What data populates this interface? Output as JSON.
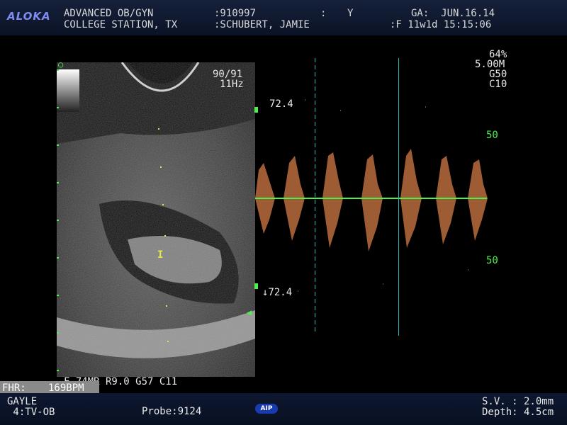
{
  "header": {
    "logo": "ALOKA",
    "clinic_line1": "ADVANCED OB/GYN",
    "clinic_line2": "COLLEGE STATION, TX",
    "id": ":910997",
    "id_sep": ":",
    "id_y": "Y",
    "patient": ":SCHUBERT, JAMIE",
    "ga": "GA:  JUN.16.14",
    "status": ":F 11w1d 15:15:06"
  },
  "bmode": {
    "frame_rate": "90/91",
    "freq": "11Hz",
    "sample_marker": "I"
  },
  "doppler": {
    "scale_top": "72.4",
    "scale_bottom": "↓72.4",
    "mark_upper": "50",
    "mark_lower": "50",
    "params": [
      "64%",
      "5.00M",
      "G50",
      "C10"
    ]
  },
  "settings_line": "F 74MR R9.0 G57 C11",
  "fhr": {
    "label": "FHR:",
    "value": "169BPM"
  },
  "footer": {
    "operator": "GAYLE",
    "preset": " 4:TV-OB",
    "probe": "Probe:9124",
    "aip": "AIP",
    "sv": "S.V. : 2.0mm",
    "depth": "Depth: 4.5cm"
  },
  "colors": {
    "doppler": "#b0663a",
    "baseline": "#4ef04e",
    "cursor": "#2fb8b8"
  }
}
